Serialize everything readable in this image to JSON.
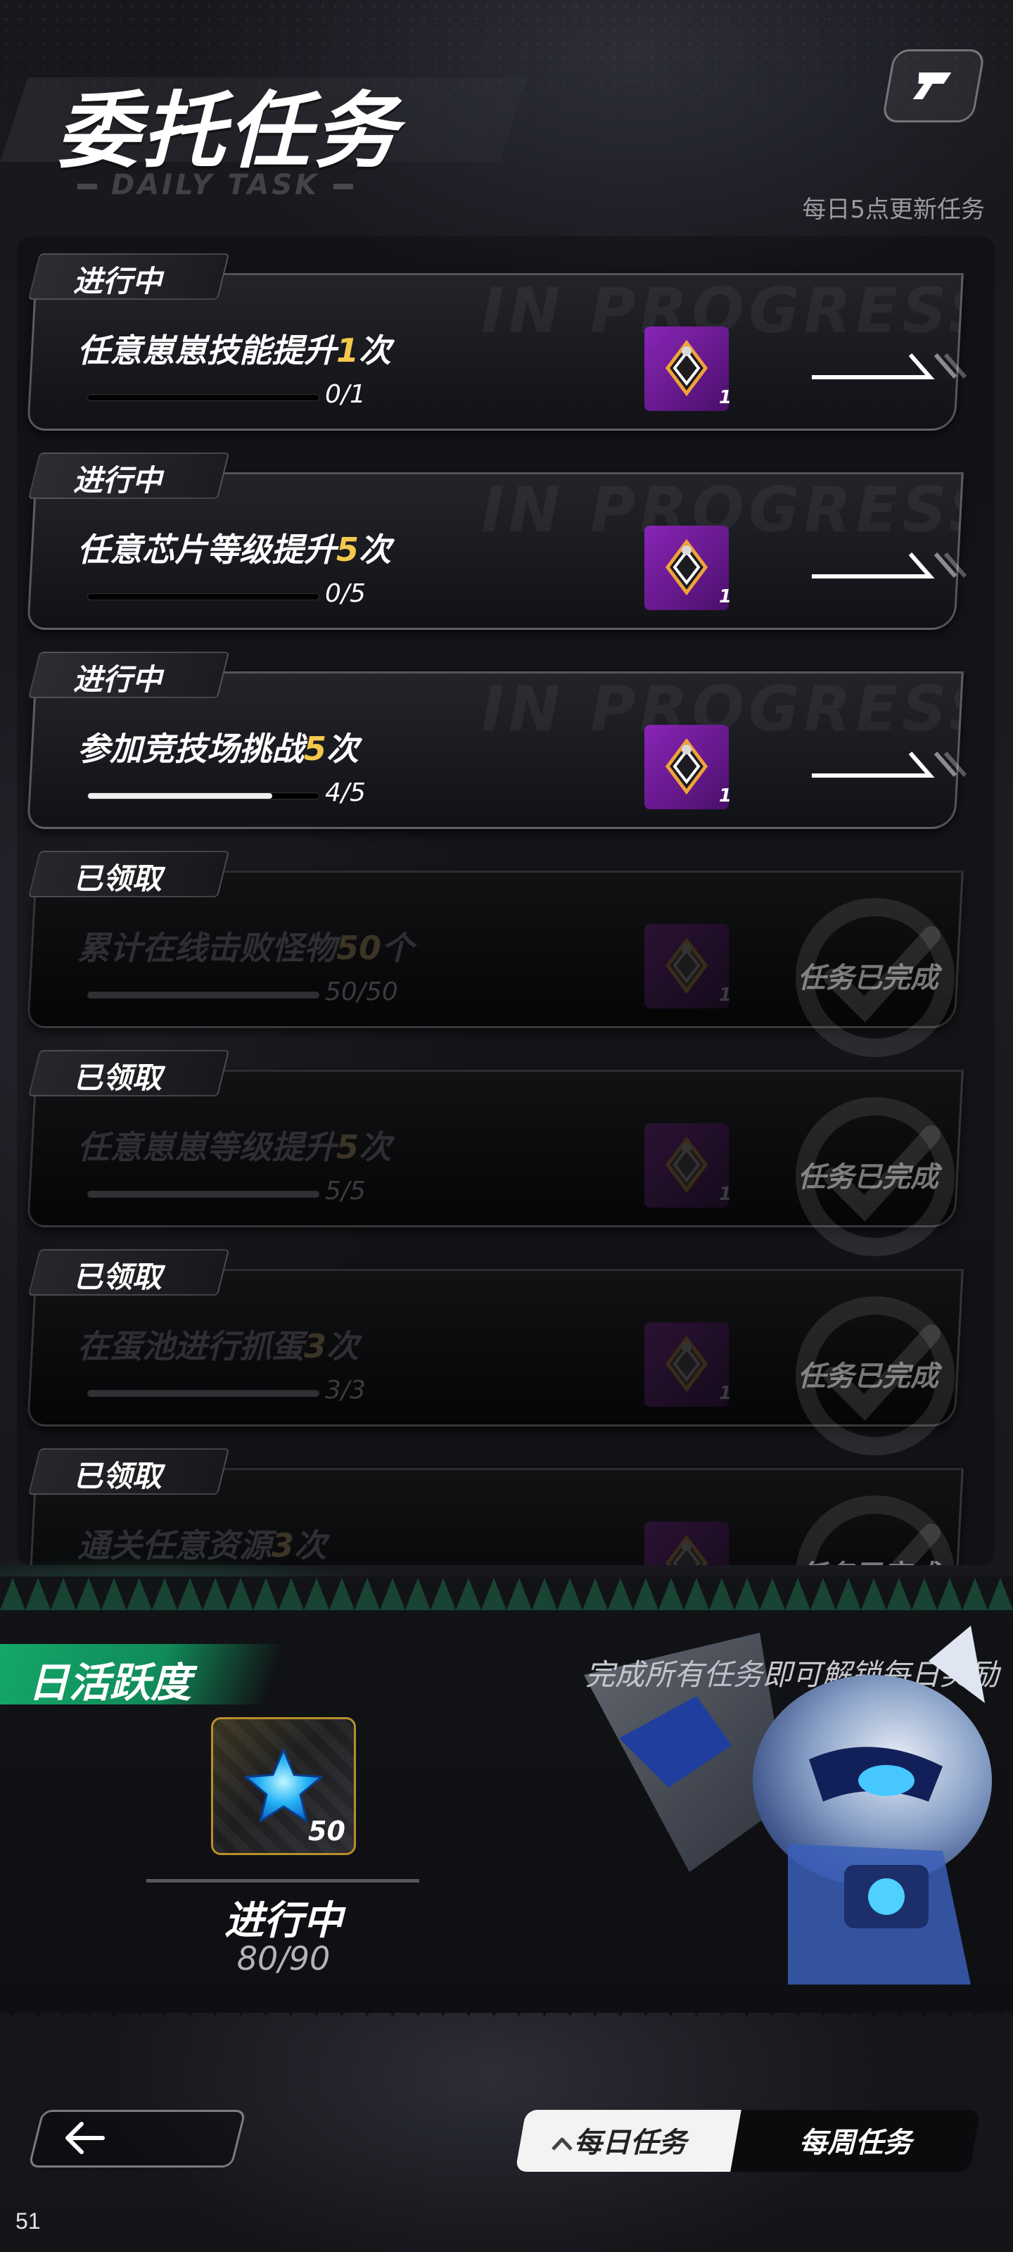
{
  "header": {
    "title": "委托任务",
    "subtitle": "DAILY TASK",
    "refresh_note": "每日5点更新任务"
  },
  "tasks": [
    {
      "status": "进行中",
      "name_prefix": "任意崽崽技能提升",
      "name_highlight": "1",
      "name_suffix": "次",
      "progress_text": "0/1",
      "progress": 0.0,
      "reward_count": "1",
      "state": "in_progress"
    },
    {
      "status": "进行中",
      "name_prefix": "任意芯片等级提升",
      "name_highlight": "5",
      "name_suffix": "次",
      "progress_text": "0/5",
      "progress": 0.0,
      "reward_count": "1",
      "state": "in_progress"
    },
    {
      "status": "进行中",
      "name_prefix": "参加竞技场挑战",
      "name_highlight": "5",
      "name_suffix": "次",
      "progress_text": "4/5",
      "progress": 0.8,
      "reward_count": "1",
      "state": "in_progress"
    },
    {
      "status": "已领取",
      "name_prefix": "累计在线击败怪物",
      "name_highlight": "50",
      "name_suffix": "个",
      "progress_text": "50/50",
      "progress": 1.0,
      "reward_count": "1",
      "state": "done",
      "done_label": "任务已完成"
    },
    {
      "status": "已领取",
      "name_prefix": "任意崽崽等级提升",
      "name_highlight": "5",
      "name_suffix": "次",
      "progress_text": "5/5",
      "progress": 1.0,
      "reward_count": "1",
      "state": "done",
      "done_label": "任务已完成"
    },
    {
      "status": "已领取",
      "name_prefix": "在蛋池进行抓蛋",
      "name_highlight": "3",
      "name_suffix": "次",
      "progress_text": "3/3",
      "progress": 1.0,
      "reward_count": "1",
      "state": "done",
      "done_label": "任务已完成"
    },
    {
      "status": "已领取",
      "name_prefix": "通关任意资源",
      "name_highlight": "3",
      "name_suffix": "次",
      "progress_text": "",
      "progress": 1.0,
      "reward_count": "",
      "state": "done",
      "done_label": "任务已完成"
    }
  ],
  "activity": {
    "title": "日活跃度",
    "unlock_hint": "完成所有任务即可解锁每日奖励",
    "reward_count": "50",
    "status": "进行中",
    "progress_text": "80/90"
  },
  "bottom_bar": {
    "tab_daily": "每日任务",
    "tab_weekly": "每周任务"
  },
  "page_number": "51",
  "colors": {
    "highlight": "#f3c84b",
    "activity_green": "#14a86a",
    "reward_purple": "#8a25b8"
  }
}
